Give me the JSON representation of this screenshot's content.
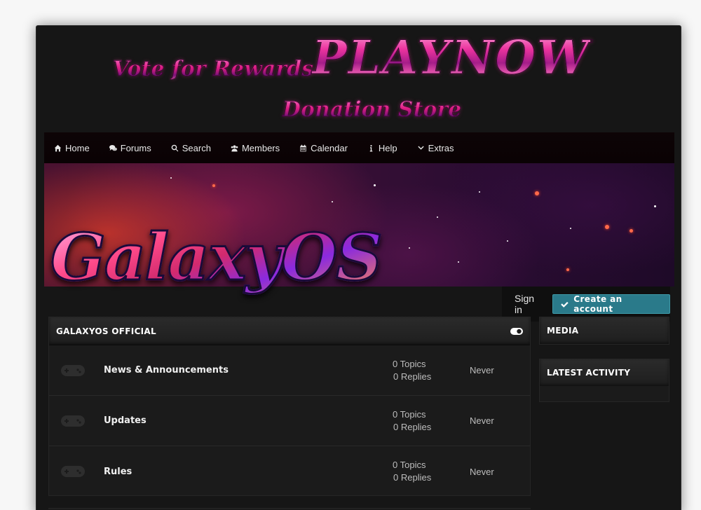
{
  "header": {
    "vote_label": "Vote for Rewards",
    "play_label": "PLAYNOW",
    "donation_label": "Donation Store"
  },
  "nav": {
    "items": [
      {
        "label": "Home",
        "icon": "home-icon"
      },
      {
        "label": "Forums",
        "icon": "comments-icon"
      },
      {
        "label": "Search",
        "icon": "search-icon"
      },
      {
        "label": "Members",
        "icon": "users-icon"
      },
      {
        "label": "Calendar",
        "icon": "calendar-icon"
      },
      {
        "label": "Help",
        "icon": "info-icon"
      },
      {
        "label": "Extras",
        "icon": "chevron-down-icon"
      }
    ]
  },
  "banner": {
    "logo_text": "GalaxyOS"
  },
  "user": {
    "signin_label": "Sign in",
    "create_label": "Create an account"
  },
  "forum": {
    "category_title": "GALAXYOS OFFICIAL",
    "rows": [
      {
        "title": "News & Announcements",
        "topics": "0 Topics",
        "replies": "0 Replies",
        "last_post": "Never"
      },
      {
        "title": "Updates",
        "topics": "0 Topics",
        "replies": "0 Replies",
        "last_post": "Never"
      },
      {
        "title": "Rules",
        "topics": "0 Topics",
        "replies": "0 Replies",
        "last_post": "Never"
      }
    ]
  },
  "sidebar": {
    "media_title": "MEDIA",
    "activity_title": "LATEST ACTIVITY"
  },
  "colors": {
    "accent": "#2a7a8a",
    "background": "#161616",
    "panel": "#1b1b1b"
  }
}
